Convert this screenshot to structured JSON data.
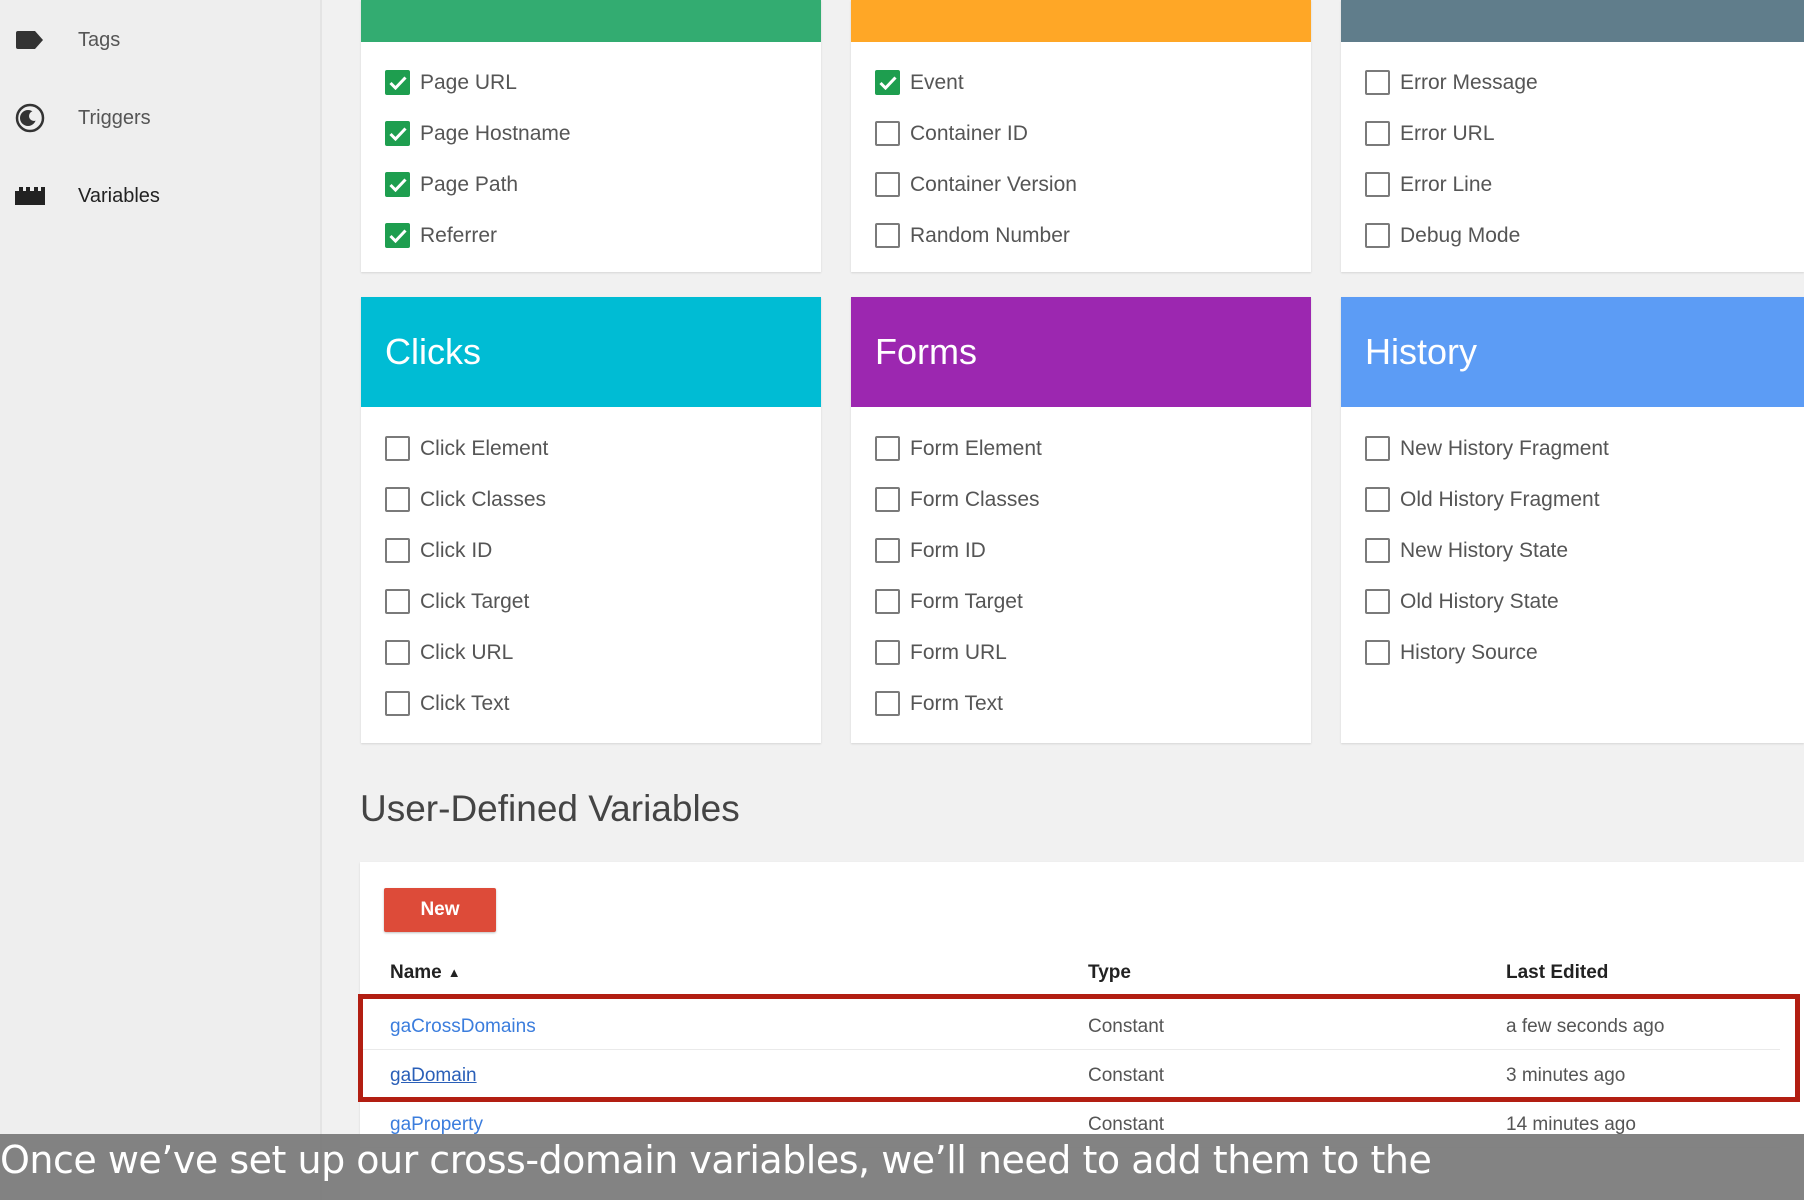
{
  "sidebar": {
    "items": [
      {
        "label": "Tags",
        "icon": "tag-icon"
      },
      {
        "label": "Triggers",
        "icon": "trigger-icon"
      },
      {
        "label": "Variables",
        "icon": "variables-icon",
        "active": true
      }
    ]
  },
  "built_in": {
    "pages": {
      "color": "#33ac71",
      "items": [
        {
          "label": "Page URL",
          "checked": true
        },
        {
          "label": "Page Hostname",
          "checked": true
        },
        {
          "label": "Page Path",
          "checked": true
        },
        {
          "label": "Referrer",
          "checked": true
        }
      ]
    },
    "utilities": {
      "color": "#ffa726",
      "items": [
        {
          "label": "Event",
          "checked": true
        },
        {
          "label": "Container ID",
          "checked": false
        },
        {
          "label": "Container Version",
          "checked": false
        },
        {
          "label": "Random Number",
          "checked": false
        }
      ]
    },
    "errors": {
      "color": "#607d8b",
      "items": [
        {
          "label": "Error Message",
          "checked": false
        },
        {
          "label": "Error URL",
          "checked": false
        },
        {
          "label": "Error Line",
          "checked": false
        },
        {
          "label": "Debug Mode",
          "checked": false
        }
      ]
    },
    "clicks": {
      "title": "Clicks",
      "color": "#00bcd4",
      "items": [
        {
          "label": "Click Element",
          "checked": false
        },
        {
          "label": "Click Classes",
          "checked": false
        },
        {
          "label": "Click ID",
          "checked": false
        },
        {
          "label": "Click Target",
          "checked": false
        },
        {
          "label": "Click URL",
          "checked": false
        },
        {
          "label": "Click Text",
          "checked": false
        }
      ]
    },
    "forms": {
      "title": "Forms",
      "color": "#9c27b0",
      "items": [
        {
          "label": "Form Element",
          "checked": false
        },
        {
          "label": "Form Classes",
          "checked": false
        },
        {
          "label": "Form ID",
          "checked": false
        },
        {
          "label": "Form Target",
          "checked": false
        },
        {
          "label": "Form URL",
          "checked": false
        },
        {
          "label": "Form Text",
          "checked": false
        }
      ]
    },
    "history": {
      "title": "History",
      "color": "#5c9cf5",
      "items": [
        {
          "label": "New History Fragment",
          "checked": false
        },
        {
          "label": "Old History Fragment",
          "checked": false
        },
        {
          "label": "New History State",
          "checked": false
        },
        {
          "label": "Old History State",
          "checked": false
        },
        {
          "label": "History Source",
          "checked": false
        }
      ]
    }
  },
  "user_defined": {
    "title": "User-Defined Variables",
    "new_button": "New",
    "new_button_color": "#dd4b39",
    "columns": {
      "name": "Name",
      "sort_icon": "▲",
      "type": "Type",
      "last_edited": "Last Edited"
    },
    "rows": [
      {
        "name": "gaCrossDomains",
        "type": "Constant",
        "last_edited": "a few seconds ago"
      },
      {
        "name": "gaDomain",
        "type": "Constant",
        "last_edited": "3 minutes ago"
      },
      {
        "name": "gaProperty",
        "type": "Constant",
        "last_edited": "14 minutes ago"
      }
    ]
  },
  "caption": "Once we’ve set up our cross-domain variables, we’ll need to add them to the"
}
